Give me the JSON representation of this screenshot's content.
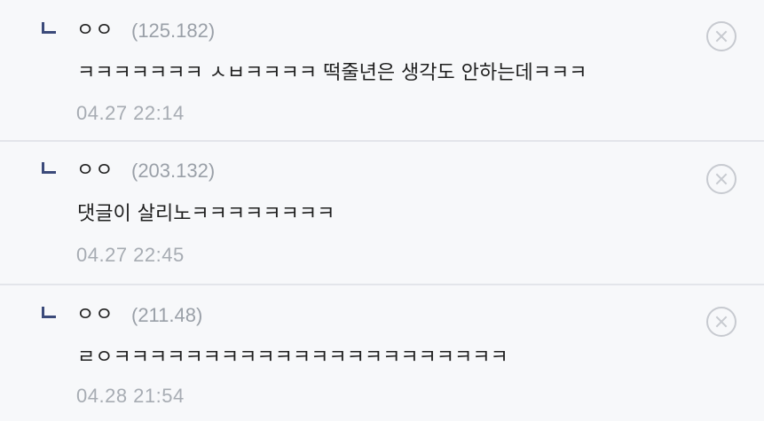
{
  "replies": [
    {
      "nickname": "ㅇㅇ",
      "ip": "(125.182)",
      "text": "ㅋㅋㅋㅋㅋㅋㅋ ㅅㅂㅋㅋㅋㅋ 떡줄년은 생각도 안하는데ㅋㅋㅋ",
      "datetime": "04.27 22:14"
    },
    {
      "nickname": "ㅇㅇ",
      "ip": "(203.132)",
      "text": "댓글이 살리노ㅋㅋㅋㅋㅋㅋㅋㅋ",
      "datetime": "04.27 22:45"
    },
    {
      "nickname": "ㅇㅇ",
      "ip": "(211.48)",
      "text": "ㄹㅇㅋㅋㅋㅋㅋㅋㅋㅋㅋㅋㅋㅋㅋㅋㅋㅋㅋㅋㅋㅋㅋㅋ",
      "datetime": "04.28 21:54"
    }
  ],
  "icons": {
    "reply_indicator": "reply-arrow-icon",
    "delete": "close-circle-icon"
  },
  "colors": {
    "row_background": "#f7f8fa",
    "divider": "#e3e5ea",
    "reply_indicator": "#3b4a7a",
    "ip_text": "#9aa0a8",
    "date_text": "#a7acb3",
    "delete_icon": "#c7cad0"
  }
}
